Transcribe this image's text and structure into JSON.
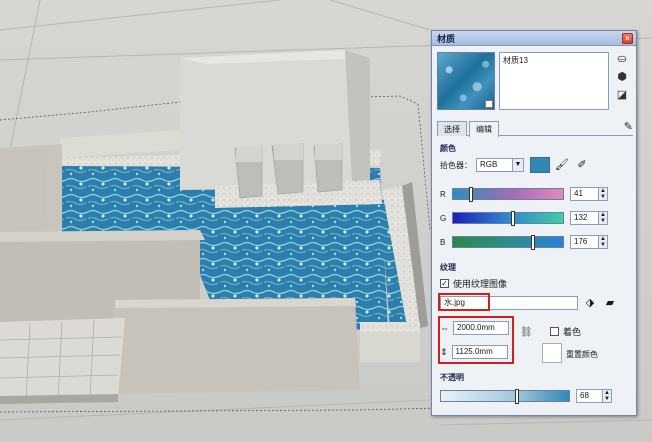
{
  "panel": {
    "title": "材质",
    "material_name": "材质13",
    "tabs": [
      "选择",
      "编辑"
    ],
    "color_section": "颜色",
    "picker_label": "拾色器：",
    "picker_value": "RGB",
    "rgb": {
      "r": 41,
      "g": 132,
      "b": 176
    },
    "slider_labels": [
      "R",
      "G",
      "B"
    ],
    "swatch_color": "#2e89b8",
    "texture_section": "纹理",
    "use_texture_label": "使用纹理图像",
    "texture_file": "水.jpg",
    "width_value": "2000.0mm",
    "height_value": "1125.0mm",
    "colorize_label": "着色",
    "reset_color_label": "重置颜色",
    "opacity_section": "不透明",
    "opacity_value": 68,
    "icons": [
      "close-icon",
      "model-icon",
      "cube-icon",
      "diagonal-icon",
      "eyedropper-icon",
      "paint-bucket-icon",
      "folder-icon",
      "chain-link-icon",
      "width-arrow-icon",
      "height-arrow-icon"
    ]
  }
}
